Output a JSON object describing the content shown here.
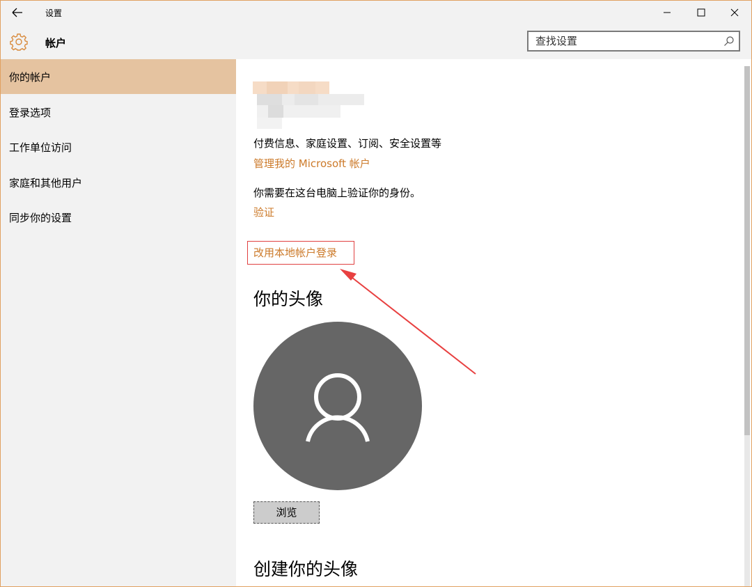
{
  "window": {
    "title": "设置",
    "controls": {
      "minimize": "minimize-icon",
      "maximize": "maximize-icon",
      "close": "close-icon"
    }
  },
  "header": {
    "title": "帐户",
    "search": {
      "placeholder": "查找设置"
    }
  },
  "sidebar": {
    "items": [
      {
        "label": "你的帐户",
        "active": true
      },
      {
        "label": "登录选项",
        "active": false
      },
      {
        "label": "工作单位访问",
        "active": false
      },
      {
        "label": "家庭和其他用户",
        "active": false
      },
      {
        "label": "同步你的设置",
        "active": false
      }
    ]
  },
  "content": {
    "account_info": "付费信息、家庭设置、订阅、安全设置等",
    "manage_link": "管理我的 Microsoft 帐户",
    "verify_prompt": "你需要在这台电脑上验证你的身份。",
    "verify_link": "验证",
    "local_account_link": "改用本地帐户登录",
    "avatar_title": "你的头像",
    "browse_label": "浏览",
    "create_avatar_title": "创建你的头像"
  },
  "colors": {
    "accent": "#cc7a2a",
    "active_nav": "#e5c3a0",
    "highlight": "#e04040",
    "avatar_bg": "#666666"
  }
}
